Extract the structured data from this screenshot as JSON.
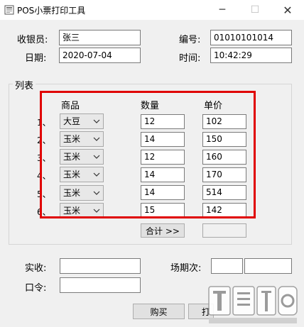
{
  "window": {
    "title": "POS小票打印工具",
    "icon": "app-icon",
    "controls": {
      "minimize": "─",
      "maximize": "☐",
      "close": "✕"
    }
  },
  "header": {
    "cashier_label": "收银员:",
    "cashier_value": "张三",
    "number_label": "编号:",
    "number_value": "01010101014",
    "date_label": "日期:",
    "date_value": "2020-07-04",
    "time_label": "时间:",
    "time_value": "10:42:29"
  },
  "list": {
    "group_title": "列表",
    "col_product": "商品",
    "col_qty": "数量",
    "col_price": "单价",
    "rows": [
      {
        "num": "1、",
        "product": "大豆",
        "qty": "12",
        "price": "102"
      },
      {
        "num": "2、",
        "product": "玉米",
        "qty": "14",
        "price": "150"
      },
      {
        "num": "3、",
        "product": "玉米",
        "qty": "12",
        "price": "160"
      },
      {
        "num": "4、",
        "product": "玉米",
        "qty": "14",
        "price": "170"
      },
      {
        "num": "5、",
        "product": "玉米",
        "qty": "14",
        "price": "514"
      },
      {
        "num": "6、",
        "product": "玉米",
        "qty": "15",
        "price": "142"
      }
    ],
    "total_button": "合计 >>",
    "total_value": ""
  },
  "footer": {
    "received_label": "实收:",
    "received_value": "",
    "session_label": "场期次:",
    "session_value_1": "",
    "session_value_2": "",
    "password_label": "口令:",
    "password_value": "",
    "buy_button": "购买",
    "print_button_partial": "打"
  },
  "colors": {
    "highlight_border": "#e00000",
    "background": "#f0f0f0"
  }
}
